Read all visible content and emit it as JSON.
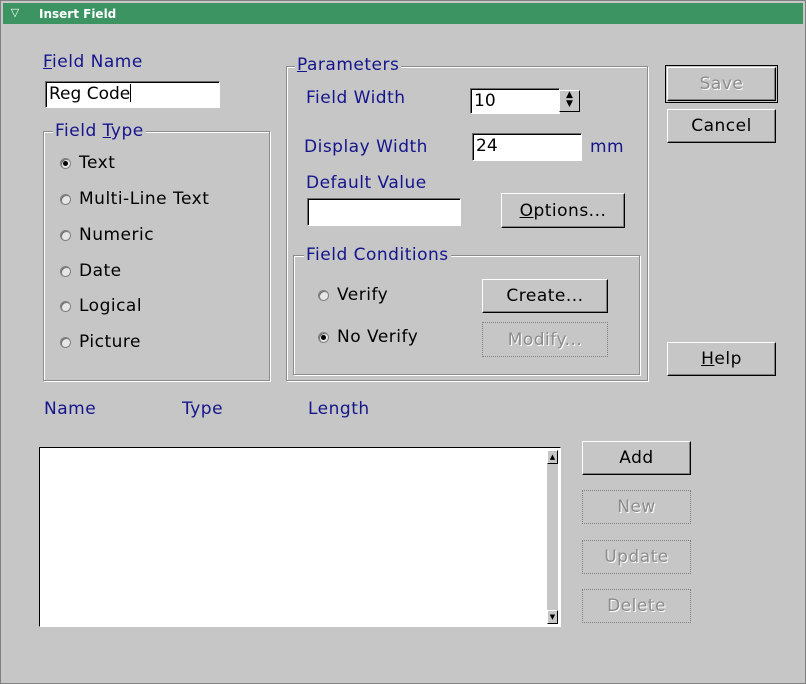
{
  "window": {
    "title": "Insert Field",
    "sysmenu_glyph": "▽"
  },
  "field_name": {
    "label_first": "F",
    "label_rest": "ield Name",
    "value": "Reg Code"
  },
  "field_type": {
    "legend_pre": "Field ",
    "legend_u": "T",
    "legend_post": "ype",
    "options": [
      {
        "label": "Text",
        "checked": true
      },
      {
        "label": "Multi-Line Text",
        "checked": false
      },
      {
        "label": "Numeric",
        "checked": false
      },
      {
        "label": "Date",
        "checked": false
      },
      {
        "label": "Logical",
        "checked": false
      },
      {
        "label": "Picture",
        "checked": false
      }
    ]
  },
  "parameters": {
    "legend_u": "P",
    "legend_rest": "arameters",
    "field_width_label": "Field Width",
    "field_width_value": "10",
    "display_width_label": "Display Width",
    "display_width_value": "24",
    "display_width_unit": "mm",
    "default_value_label": "Default Value",
    "default_value": "",
    "options_button_u": "O",
    "options_button_rest": "ptions...",
    "spin_up": "▲",
    "spin_down": "▼"
  },
  "field_conditions": {
    "legend": "Field Conditions",
    "verify_label": "Verify",
    "no_verify_label": "No Verify",
    "create_button": "Create...",
    "modify_button": "Modify..."
  },
  "buttons": {
    "save": "Save",
    "cancel": "Cancel",
    "help_u": "H",
    "help_rest": "elp",
    "add": "Add",
    "new": "New",
    "update": "Update",
    "delete": "Delete"
  },
  "list": {
    "columns": [
      "Name",
      "Type",
      "Length"
    ],
    "rows": [],
    "scroll_up": "▲",
    "scroll_down": "▼"
  },
  "colors": {
    "title_bar": "#3b9462",
    "label": "#14148c",
    "face": "#c6c6c6"
  }
}
